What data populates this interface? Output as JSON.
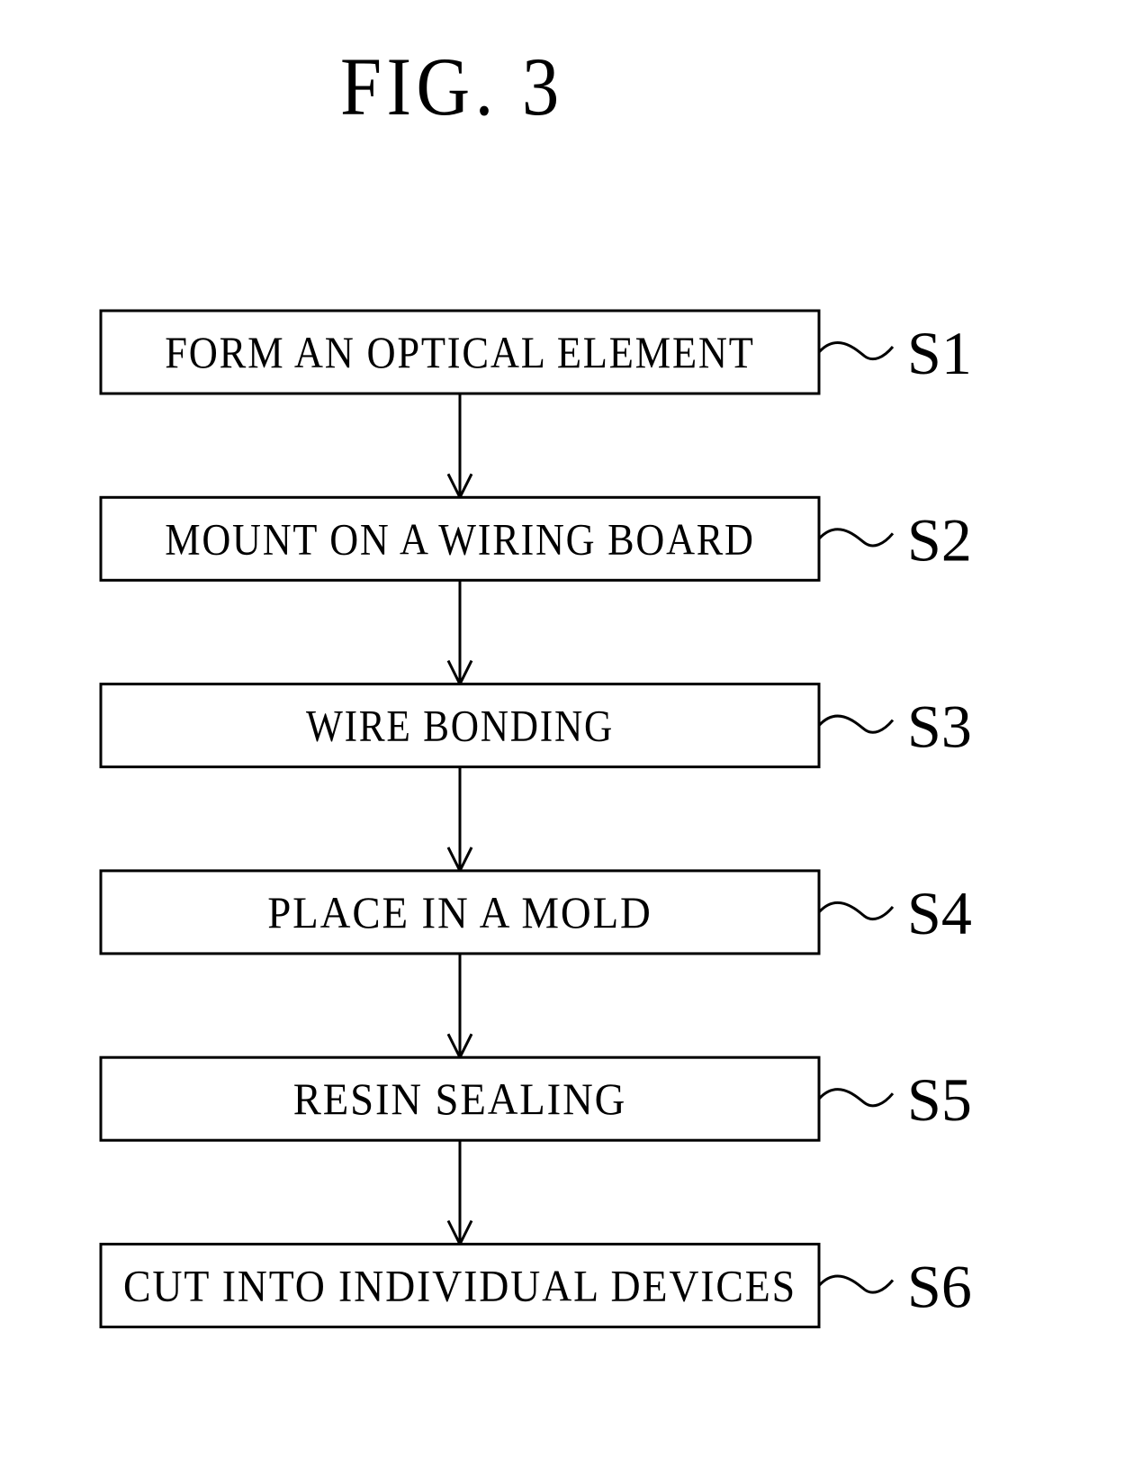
{
  "figure": {
    "title": "FIG. 3"
  },
  "steps": [
    {
      "id": "S1",
      "text": "FORM AN OPTICAL ELEMENT"
    },
    {
      "id": "S2",
      "text": "MOUNT ON A WIRING BOARD"
    },
    {
      "id": "S3",
      "text": "WIRE BONDING"
    },
    {
      "id": "S4",
      "text": "PLACE IN A MOLD"
    },
    {
      "id": "S5",
      "text": "RESIN SEALING"
    },
    {
      "id": "S6",
      "text": "CUT INTO INDIVIDUAL DEVICES"
    }
  ]
}
